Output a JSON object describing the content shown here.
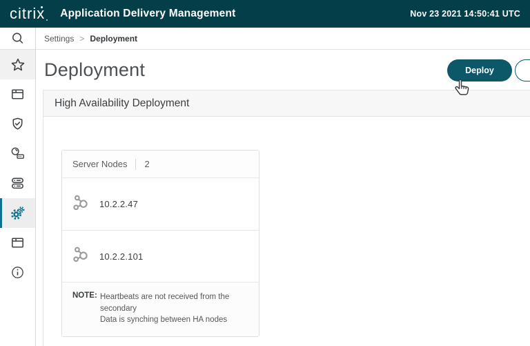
{
  "header": {
    "logo": "citrix",
    "title": "Application Delivery Management",
    "timestamp": "Nov 23 2021 14:50:41 UTC"
  },
  "sidebar": {
    "items": [
      {
        "icon": "search-icon"
      },
      {
        "icon": "star-favorites-icon"
      },
      {
        "icon": "applications-window-icon"
      },
      {
        "icon": "security-shield-icon"
      },
      {
        "icon": "orchestration-gateway-icon"
      },
      {
        "icon": "infrastructure-servers-icon"
      },
      {
        "icon": "settings-gears-icon",
        "state": "selected"
      },
      {
        "icon": "networks-window-icon"
      },
      {
        "icon": "info-icon"
      }
    ]
  },
  "breadcrumb": {
    "items": [
      "Settings",
      "Deployment"
    ],
    "separator": ">"
  },
  "page": {
    "title": "Deployment",
    "deploy_button": "Deploy"
  },
  "section": {
    "title": "High Availability Deployment"
  },
  "card": {
    "header_label": "Server Nodes",
    "count": "2",
    "nodes": [
      "10.2.2.47",
      "10.2.2.101"
    ],
    "note_label": "NOTE:",
    "note_lines": [
      "Heartbeats are not received from the secondary",
      "Data is synching between HA nodes"
    ]
  },
  "colors": {
    "header_bg": "#043e48",
    "accent_teal": "#0d5868",
    "selected_teal": "#0f7390",
    "section_header_bg": "#f7f7f7"
  }
}
